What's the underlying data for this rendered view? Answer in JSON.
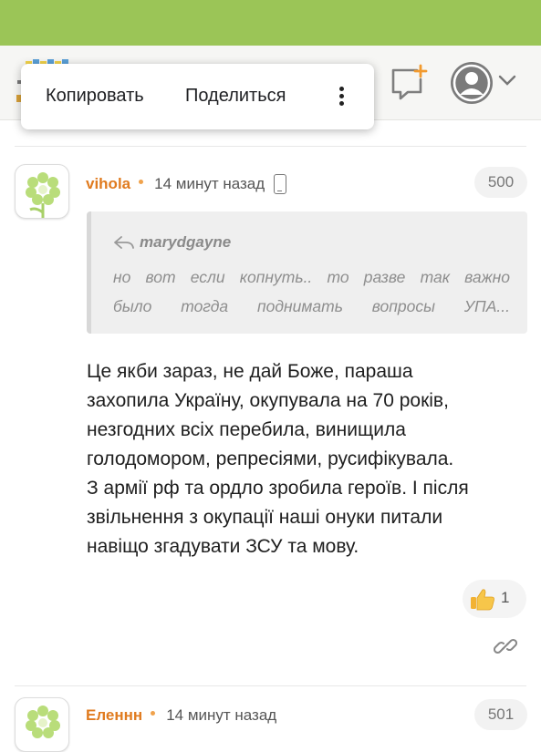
{
  "context_menu": {
    "copy_label": "Копировать",
    "share_label": "Поделиться",
    "more_icon": "more-vertical-icon"
  },
  "header": {
    "logo_icon": "site-logo-icon",
    "messages_icon": "message-plus-icon",
    "profile_icon": "user-avatar-icon",
    "menu_icon": "chevron-down-icon",
    "brand_color": "#9bc557"
  },
  "comments": [
    {
      "author": "vihola",
      "time": "14 минут назад",
      "device_icon": "mobile-phone-icon",
      "number": "500",
      "quote": {
        "author": "marydgayne",
        "line1": "но вот если копнуть.. то разве так важно",
        "line2": "было тогда поднимать вопросы УПА..."
      },
      "text_lines": [
        "Це якби зараз, не дай Боже, параша",
        "захопила Україну, окупувала на 70 років,",
        "незгодних всіх перебила, винищила",
        "голодомором, репресіями, русифікувала.",
        "З армії рф та ордло зробила героїв. І після",
        "звільнення з окупації наші онуки питали",
        "навіщо згадувати ЗСУ та мову."
      ],
      "likes": "1"
    },
    {
      "author": "Еленнн",
      "time": "14 минут назад",
      "number": "501"
    }
  ],
  "colors": {
    "author": "#e07b1f",
    "quote_bg": "#efefef"
  }
}
